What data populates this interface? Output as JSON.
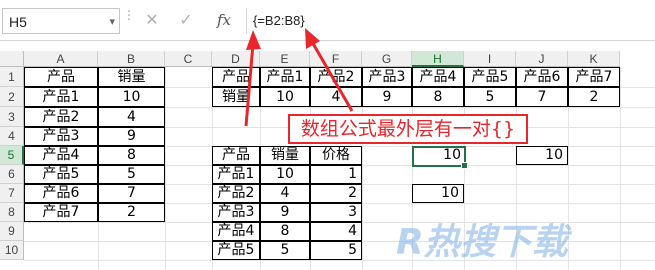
{
  "formula_bar": {
    "name_box": "H5",
    "cancel_icon": "✕",
    "enter_icon": "✓",
    "fx_label": "fx",
    "formula": "{=B2:B8}"
  },
  "columns": [
    "A",
    "B",
    "C",
    "D",
    "E",
    "F",
    "G",
    "H",
    "I",
    "J",
    "K"
  ],
  "rows": [
    "1",
    "2",
    "3",
    "4",
    "5",
    "6",
    "7",
    "8",
    "9",
    "10"
  ],
  "selected_column": "H",
  "selected_row": "5",
  "sheet": {
    "a_col": [
      "产品",
      "产品1",
      "产品2",
      "产品3",
      "产品4",
      "产品5",
      "产品6",
      "产品7"
    ],
    "b_col": [
      "销量",
      "10",
      "4",
      "9",
      "8",
      "5",
      "7",
      "2"
    ],
    "row1_labels": [
      "产品",
      "产品1",
      "产品2",
      "产品3",
      "产品4",
      "产品5",
      "产品6",
      "产品7"
    ],
    "row2_values": [
      "销量",
      "10",
      "4",
      "9",
      "8",
      "5",
      "7",
      "2"
    ],
    "t2_header": [
      "产品",
      "销量",
      "价格"
    ],
    "t2_rows": [
      [
        "产品1",
        "10",
        "1"
      ],
      [
        "产品2",
        "4",
        "2"
      ],
      [
        "产品3",
        "9",
        "3"
      ],
      [
        "产品4",
        "8",
        "4"
      ],
      [
        "产品5",
        "5",
        "5"
      ]
    ],
    "h5": "10",
    "h7": "10",
    "j5": "10"
  },
  "annotation": "数组公式最外层有一对{}",
  "colors": {
    "accent": "#217346",
    "callout": "#e8262c"
  },
  "watermark": "R热搜下载"
}
